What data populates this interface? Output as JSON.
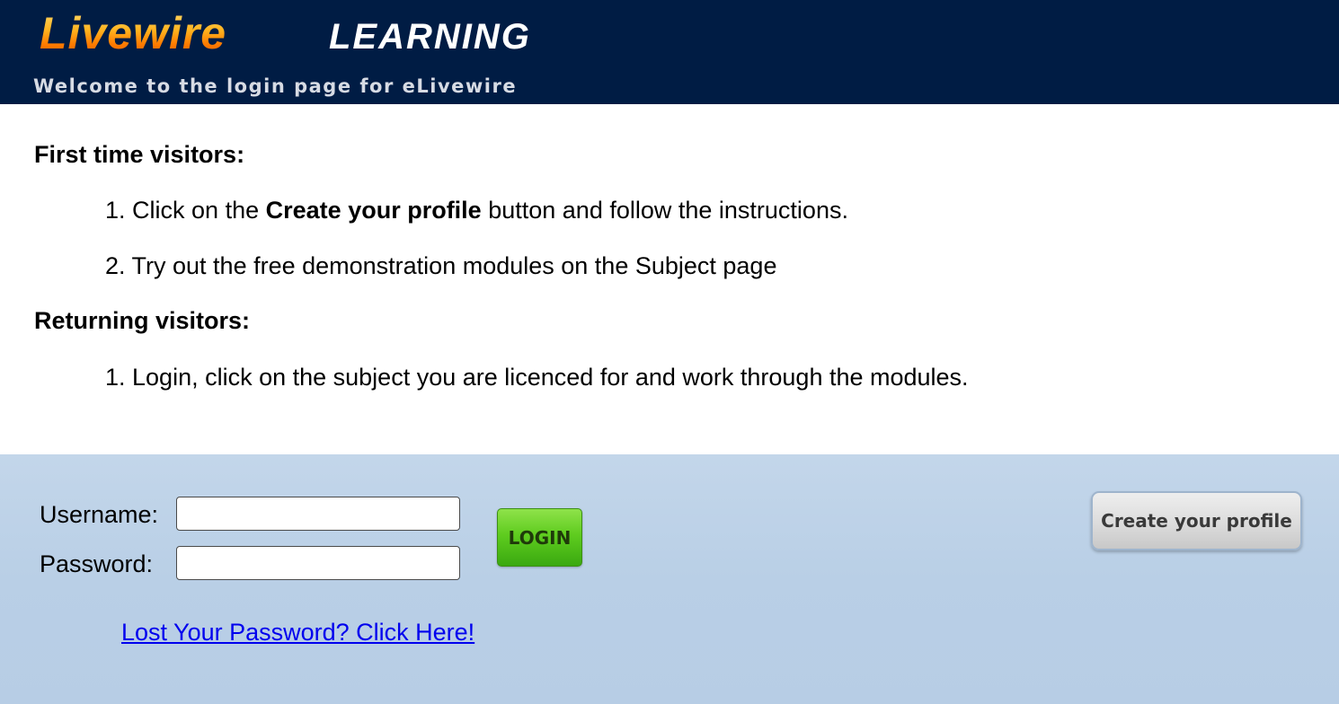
{
  "header": {
    "logo_part1": "Livewire",
    "logo_part2": "LEARNING",
    "welcome": "Welcome to the login page for eLivewire"
  },
  "instructions": {
    "first_time": {
      "title": "First time visitors:",
      "step1_num": "1.",
      "step1_pre": "Click on the",
      "step1_bold": "Create your profile",
      "step1_post": "button and follow the instructions.",
      "step2": "2. Try out the free demonstration modules on the Subject page"
    },
    "returning": {
      "title": "Returning visitors:",
      "step1": "1. Login, click on the subject you are licenced for and work through the modules."
    }
  },
  "login": {
    "username_label": "Username:",
    "username_value": "",
    "password_label": "Password:",
    "password_value": "",
    "login_button": "LOGIN",
    "create_profile_button": "Create your profile",
    "lost_password_link": "Lost Your Password? Click Here!"
  },
  "colors": {
    "header_bg": "#001c44",
    "panel_bg": "#b9cfe6",
    "login_green": "#5fcc1f",
    "link": "#0000ee"
  }
}
